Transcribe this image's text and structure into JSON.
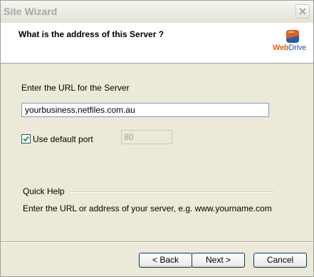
{
  "window": {
    "title": "Site Wizard"
  },
  "header": {
    "title": "What is the address of this Server ?",
    "logo": {
      "web": "Web",
      "drive": "Drive",
      "icon": "webdrive-logo-icon"
    }
  },
  "form": {
    "url_label": "Enter the URL for the Server",
    "url_value": "yourbusiness.netfiles.com.au",
    "default_port_label": "Use default port",
    "default_port_checked": true,
    "port_value": "80"
  },
  "help": {
    "heading": "Quick Help",
    "text": "Enter the URL or address of your server, e.g. www.yourname.com"
  },
  "buttons": {
    "back": "< Back",
    "next": "Next >",
    "cancel": "Cancel"
  },
  "colors": {
    "accent_orange": "#e0601c",
    "accent_blue": "#2a5ea8",
    "checkmark": "#21a121"
  }
}
